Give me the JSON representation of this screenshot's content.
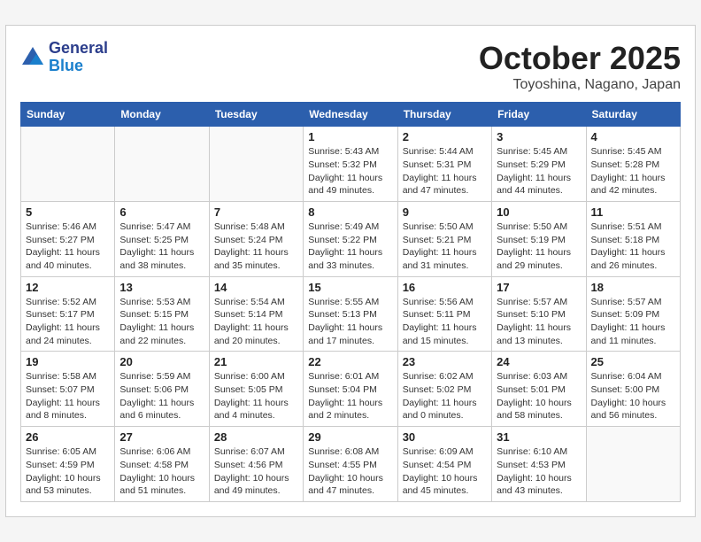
{
  "header": {
    "logo_general": "General",
    "logo_blue": "Blue",
    "month_title": "October 2025",
    "location": "Toyoshina, Nagano, Japan"
  },
  "weekdays": [
    "Sunday",
    "Monday",
    "Tuesday",
    "Wednesday",
    "Thursday",
    "Friday",
    "Saturday"
  ],
  "weeks": [
    [
      {
        "day": "",
        "info": ""
      },
      {
        "day": "",
        "info": ""
      },
      {
        "day": "",
        "info": ""
      },
      {
        "day": "1",
        "info": "Sunrise: 5:43 AM\nSunset: 5:32 PM\nDaylight: 11 hours\nand 49 minutes."
      },
      {
        "day": "2",
        "info": "Sunrise: 5:44 AM\nSunset: 5:31 PM\nDaylight: 11 hours\nand 47 minutes."
      },
      {
        "day": "3",
        "info": "Sunrise: 5:45 AM\nSunset: 5:29 PM\nDaylight: 11 hours\nand 44 minutes."
      },
      {
        "day": "4",
        "info": "Sunrise: 5:45 AM\nSunset: 5:28 PM\nDaylight: 11 hours\nand 42 minutes."
      }
    ],
    [
      {
        "day": "5",
        "info": "Sunrise: 5:46 AM\nSunset: 5:27 PM\nDaylight: 11 hours\nand 40 minutes."
      },
      {
        "day": "6",
        "info": "Sunrise: 5:47 AM\nSunset: 5:25 PM\nDaylight: 11 hours\nand 38 minutes."
      },
      {
        "day": "7",
        "info": "Sunrise: 5:48 AM\nSunset: 5:24 PM\nDaylight: 11 hours\nand 35 minutes."
      },
      {
        "day": "8",
        "info": "Sunrise: 5:49 AM\nSunset: 5:22 PM\nDaylight: 11 hours\nand 33 minutes."
      },
      {
        "day": "9",
        "info": "Sunrise: 5:50 AM\nSunset: 5:21 PM\nDaylight: 11 hours\nand 31 minutes."
      },
      {
        "day": "10",
        "info": "Sunrise: 5:50 AM\nSunset: 5:19 PM\nDaylight: 11 hours\nand 29 minutes."
      },
      {
        "day": "11",
        "info": "Sunrise: 5:51 AM\nSunset: 5:18 PM\nDaylight: 11 hours\nand 26 minutes."
      }
    ],
    [
      {
        "day": "12",
        "info": "Sunrise: 5:52 AM\nSunset: 5:17 PM\nDaylight: 11 hours\nand 24 minutes."
      },
      {
        "day": "13",
        "info": "Sunrise: 5:53 AM\nSunset: 5:15 PM\nDaylight: 11 hours\nand 22 minutes."
      },
      {
        "day": "14",
        "info": "Sunrise: 5:54 AM\nSunset: 5:14 PM\nDaylight: 11 hours\nand 20 minutes."
      },
      {
        "day": "15",
        "info": "Sunrise: 5:55 AM\nSunset: 5:13 PM\nDaylight: 11 hours\nand 17 minutes."
      },
      {
        "day": "16",
        "info": "Sunrise: 5:56 AM\nSunset: 5:11 PM\nDaylight: 11 hours\nand 15 minutes."
      },
      {
        "day": "17",
        "info": "Sunrise: 5:57 AM\nSunset: 5:10 PM\nDaylight: 11 hours\nand 13 minutes."
      },
      {
        "day": "18",
        "info": "Sunrise: 5:57 AM\nSunset: 5:09 PM\nDaylight: 11 hours\nand 11 minutes."
      }
    ],
    [
      {
        "day": "19",
        "info": "Sunrise: 5:58 AM\nSunset: 5:07 PM\nDaylight: 11 hours\nand 8 minutes."
      },
      {
        "day": "20",
        "info": "Sunrise: 5:59 AM\nSunset: 5:06 PM\nDaylight: 11 hours\nand 6 minutes."
      },
      {
        "day": "21",
        "info": "Sunrise: 6:00 AM\nSunset: 5:05 PM\nDaylight: 11 hours\nand 4 minutes."
      },
      {
        "day": "22",
        "info": "Sunrise: 6:01 AM\nSunset: 5:04 PM\nDaylight: 11 hours\nand 2 minutes."
      },
      {
        "day": "23",
        "info": "Sunrise: 6:02 AM\nSunset: 5:02 PM\nDaylight: 11 hours\nand 0 minutes."
      },
      {
        "day": "24",
        "info": "Sunrise: 6:03 AM\nSunset: 5:01 PM\nDaylight: 10 hours\nand 58 minutes."
      },
      {
        "day": "25",
        "info": "Sunrise: 6:04 AM\nSunset: 5:00 PM\nDaylight: 10 hours\nand 56 minutes."
      }
    ],
    [
      {
        "day": "26",
        "info": "Sunrise: 6:05 AM\nSunset: 4:59 PM\nDaylight: 10 hours\nand 53 minutes."
      },
      {
        "day": "27",
        "info": "Sunrise: 6:06 AM\nSunset: 4:58 PM\nDaylight: 10 hours\nand 51 minutes."
      },
      {
        "day": "28",
        "info": "Sunrise: 6:07 AM\nSunset: 4:56 PM\nDaylight: 10 hours\nand 49 minutes."
      },
      {
        "day": "29",
        "info": "Sunrise: 6:08 AM\nSunset: 4:55 PM\nDaylight: 10 hours\nand 47 minutes."
      },
      {
        "day": "30",
        "info": "Sunrise: 6:09 AM\nSunset: 4:54 PM\nDaylight: 10 hours\nand 45 minutes."
      },
      {
        "day": "31",
        "info": "Sunrise: 6:10 AM\nSunset: 4:53 PM\nDaylight: 10 hours\nand 43 minutes."
      },
      {
        "day": "",
        "info": ""
      }
    ]
  ]
}
